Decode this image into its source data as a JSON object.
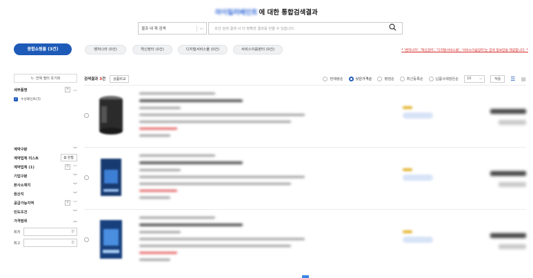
{
  "header": {
    "keyword_blurred": "마이킬러베인트",
    "title_suffix": "에 대한 통합검색결과"
  },
  "search": {
    "scope_label": "결과 내 재 검색",
    "placeholder": "조건 검색 결색 시 더 정확한 결과를 얻을 수 있습니다."
  },
  "tabs": {
    "all_mall": "종합쇼핑몰 (3건)",
    "categories": [
      "벤처나라 (0건)",
      "혁신장터 (0건)",
      "디지털서비스몰 (0건)",
      "서비스이음장터 (0건)"
    ],
    "notice": "* '벤처나라', '혁신장터', '디지털서비스몰', '서비스이음장터'는 검색 정보만을 제공합니다. *"
  },
  "sidebar": {
    "reset_label": "전체 필터 초기화",
    "detail_label": "세부품명",
    "detail_checked_item": "수성페인트(3)",
    "contract_type": "계약구분",
    "contract_list": "계약업체 리스트",
    "list_button": "현황",
    "contractor": "계약업체 (1)",
    "company_type": "기업구분",
    "hq_location": "본사소재지",
    "origin": "원산지",
    "supply_region": "공급가능지역",
    "delivery": "인도조건",
    "price_range": "가격범위",
    "min_label": "최저",
    "max_label": "최고",
    "currency": "원"
  },
  "results": {
    "count_prefix": "검색결과",
    "count_num": "3",
    "count_suffix": "건",
    "compare_button": "상품비교",
    "sort_options": [
      "판매량순",
      "낮은가격순",
      "평점순",
      "최신등록순",
      "납품사례많은순"
    ],
    "sort_selected": 1,
    "per_page": "10",
    "apply_button": "적용",
    "product_count": 3
  }
}
